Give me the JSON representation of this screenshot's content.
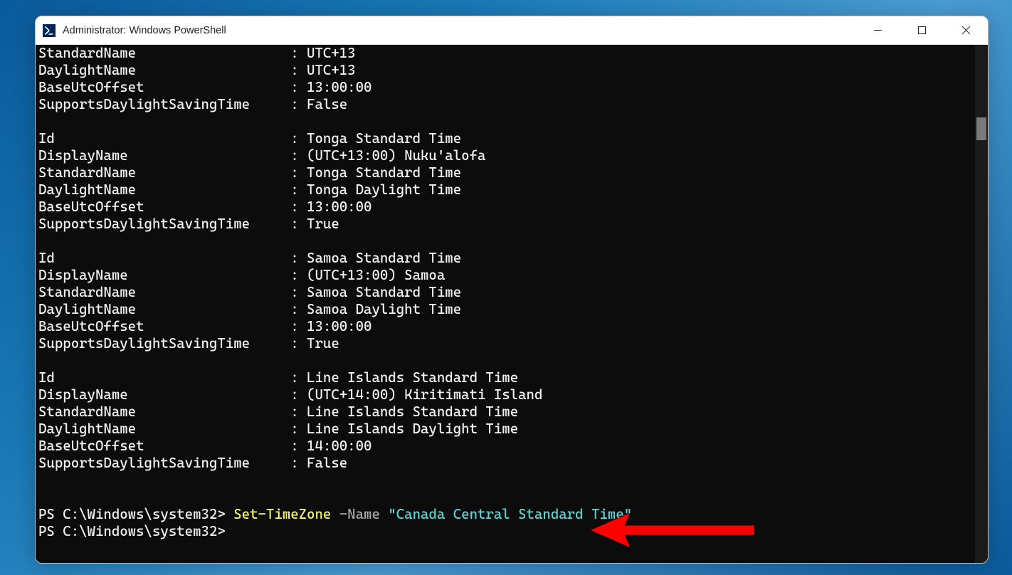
{
  "window": {
    "title": "Administrator: Windows PowerShell"
  },
  "timezones": [
    {
      "partial": true,
      "StandardName": "UTC+13",
      "DaylightName": "UTC+13",
      "BaseUtcOffset": "13:00:00",
      "SupportsDaylightSavingTime": "False"
    },
    {
      "Id": "Tonga Standard Time",
      "DisplayName": "(UTC+13:00) Nuku'alofa",
      "StandardName": "Tonga Standard Time",
      "DaylightName": "Tonga Daylight Time",
      "BaseUtcOffset": "13:00:00",
      "SupportsDaylightSavingTime": "True"
    },
    {
      "Id": "Samoa Standard Time",
      "DisplayName": "(UTC+13:00) Samoa",
      "StandardName": "Samoa Standard Time",
      "DaylightName": "Samoa Daylight Time",
      "BaseUtcOffset": "13:00:00",
      "SupportsDaylightSavingTime": "True"
    },
    {
      "Id": "Line Islands Standard Time",
      "DisplayName": "(UTC+14:00) Kiritimati Island",
      "StandardName": "Line Islands Standard Time",
      "DaylightName": "Line Islands Daylight Time",
      "BaseUtcOffset": "14:00:00",
      "SupportsDaylightSavingTime": "False"
    }
  ],
  "labels": {
    "Id": "Id",
    "DisplayName": "DisplayName",
    "StandardName": "StandardName",
    "DaylightName": "DaylightName",
    "BaseUtcOffset": "BaseUtcOffset",
    "SupportsDaylightSavingTime": "SupportsDaylightSavingTime"
  },
  "prompts": [
    {
      "path": "PS C:\\Windows\\system32> ",
      "cmd": "Set-TimeZone",
      "param": " -Name ",
      "arg": "\"Canada Central Standard Time\""
    },
    {
      "path": "PS C:\\Windows\\system32>",
      "cmd": "",
      "param": "",
      "arg": ""
    }
  ]
}
